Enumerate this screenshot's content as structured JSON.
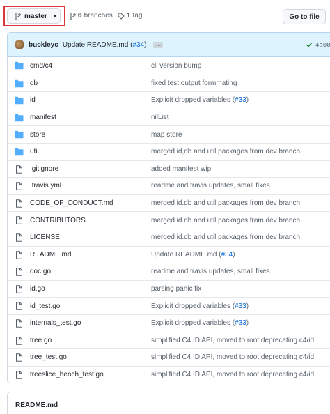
{
  "branch": {
    "name": "master"
  },
  "stats": {
    "branches_count": "6",
    "branches_label": "branches",
    "tags_count": "1",
    "tags_label": "tag"
  },
  "goto_file_label": "Go to file",
  "latest_commit": {
    "author": "buckleyc",
    "message": "Update README.md (",
    "pr": "#34",
    "message_end": ")",
    "ellipsis": "…",
    "sha": "4a00"
  },
  "files": [
    {
      "type": "dir",
      "name": "cmd/c4",
      "message": "cli version bump"
    },
    {
      "type": "dir",
      "name": "db",
      "message": "fixed test output formmating"
    },
    {
      "type": "dir",
      "name": "id",
      "message": "Explicit dropped variables (",
      "pr": "#33",
      "message_end": ")"
    },
    {
      "type": "dir",
      "name": "manifest",
      "message": "nilList"
    },
    {
      "type": "dir",
      "name": "store",
      "message": "map store"
    },
    {
      "type": "dir",
      "name": "util",
      "message": "merged id,db and util packages from dev branch"
    },
    {
      "type": "file",
      "name": ".gitignore",
      "message": "added manifest wip"
    },
    {
      "type": "file",
      "name": ".travis.yml",
      "message": "readme and travis updates, small fixes"
    },
    {
      "type": "file",
      "name": "CODE_OF_CONDUCT.md",
      "message": "merged id.db and util packages from dev branch"
    },
    {
      "type": "file",
      "name": "CONTRIBUTORS",
      "message": "merged id.db and util packages from dev branch"
    },
    {
      "type": "file",
      "name": "LICENSE",
      "message": "merged id.db and util packages from dev branch"
    },
    {
      "type": "file",
      "name": "README.md",
      "message": "Update README.md (",
      "pr": "#34",
      "message_end": ")"
    },
    {
      "type": "file",
      "name": "doc.go",
      "message": "readme and travis updates, small fixes"
    },
    {
      "type": "file",
      "name": "id.go",
      "message": "parsing panic fix"
    },
    {
      "type": "file",
      "name": "id_test.go",
      "message": "Explicit dropped variables (",
      "pr": "#33",
      "message_end": ")"
    },
    {
      "type": "file",
      "name": "internals_test.go",
      "message": "Explicit dropped variables (",
      "pr": "#33",
      "message_end": ")"
    },
    {
      "type": "file",
      "name": "tree.go",
      "message": "simplified C4 ID API, moved to root deprecating c4/id"
    },
    {
      "type": "file",
      "name": "tree_test.go",
      "message": "simplified C4 ID API, moved to root deprecating c4/id"
    },
    {
      "type": "file",
      "name": "treeslice_bench_test.go",
      "message": "simplified C4 ID API, moved to root deprecating c4/id"
    }
  ],
  "readme": {
    "title": "README.md"
  },
  "colors": {
    "folder": "#54aeff",
    "file": "#57606a",
    "link": "#0969da",
    "check": "#1a7f37",
    "highlight": "#d9383a"
  }
}
